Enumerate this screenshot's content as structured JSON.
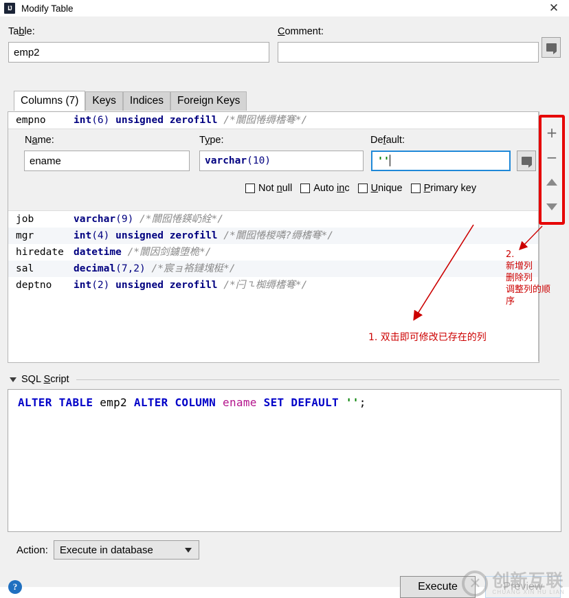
{
  "window": {
    "title": "Modify Table",
    "icon": "IJ",
    "close_label": "✕"
  },
  "form": {
    "table_label": "Table:",
    "table_label_mnemonic": "b",
    "table_value": "emp2",
    "comment_label": "Comment:",
    "comment_value": "",
    "comment_memo_icon": "memo-icon"
  },
  "tabs": [
    {
      "label": "Columns (7)",
      "active": true
    },
    {
      "label": "Keys",
      "active": false
    },
    {
      "label": "Indices",
      "active": false
    },
    {
      "label": "Foreign Keys",
      "active": false
    }
  ],
  "columns_above": [
    {
      "name": "empno",
      "type": "int",
      "args": "(6)",
      "suffix": " unsigned zerofill",
      "comment": "/*闤囮惓缛榰弿*/"
    }
  ],
  "editor": {
    "name_label": "Name:",
    "name_value": "ename",
    "type_label": "Type:",
    "type_value_kw": "varchar",
    "type_value_args": "(10)",
    "default_label": "Default:",
    "default_value": "''",
    "default_memo_icon": "memo-icon",
    "checkboxes": [
      {
        "label": "Not null",
        "checked": false
      },
      {
        "label": "Auto inc",
        "checked": false
      },
      {
        "label": "Unique",
        "checked": false
      },
      {
        "label": "Primary key",
        "checked": false
      }
    ]
  },
  "columns_below": [
    {
      "name": "job",
      "type": "varchar",
      "args": "(9)",
      "suffix": "",
      "comment": "/*闤囮惓鍈屷絟*/"
    },
    {
      "name": "mgr",
      "type": "int",
      "args": "(4)",
      "suffix": " unsigned zerofill",
      "comment": "/*闤囮惓椶噒?缛榰弿*/"
    },
    {
      "name": "hiredate",
      "type": "datetime",
      "args": "",
      "suffix": "",
      "comment": "/*闤因剑鐪堕桅*/"
    },
    {
      "name": "sal",
      "type": "decimal",
      "args": "(7,2)",
      "suffix": "",
      "comment": "/*宸ョ袼鏈塊梃*/"
    },
    {
      "name": "deptno",
      "type": "int",
      "args": "(2)",
      "suffix": " unsigned zerofill",
      "comment": "/*闩㇍椥缛榰弿*/"
    }
  ],
  "toolbar": {
    "add_label": "+",
    "remove_label": "−",
    "move_up_icon": "triangle-up-icon",
    "move_down_icon": "triangle-down-icon",
    "highlight_color": "#e60000"
  },
  "annotations": {
    "one": "1.  双击即可修改已存在的列",
    "two": "2.\n新增列\n删除列\n调整列的顺序",
    "color": "#cc0000"
  },
  "sql_section": {
    "title": "SQL Script",
    "collapse_icon": "caret-down-icon",
    "statement": {
      "tokens": [
        {
          "text": "ALTER",
          "kind": "kw"
        },
        {
          "text": " ",
          "kind": "plain"
        },
        {
          "text": "TABLE",
          "kind": "kw"
        },
        {
          "text": " ",
          "kind": "plain"
        },
        {
          "text": "emp2",
          "kind": "ident"
        },
        {
          "text": " ",
          "kind": "plain"
        },
        {
          "text": "ALTER",
          "kind": "kw"
        },
        {
          "text": " ",
          "kind": "plain"
        },
        {
          "text": "COLUMN",
          "kind": "kw"
        },
        {
          "text": " ",
          "kind": "plain"
        },
        {
          "text": "ename",
          "kind": "colname"
        },
        {
          "text": " ",
          "kind": "plain"
        },
        {
          "text": "SET",
          "kind": "kw"
        },
        {
          "text": " ",
          "kind": "plain"
        },
        {
          "text": "DEFAULT",
          "kind": "kw"
        },
        {
          "text": " ",
          "kind": "plain"
        },
        {
          "text": "''",
          "kind": "strlit"
        },
        {
          "text": ";",
          "kind": "punct"
        }
      ],
      "plain": "ALTER TABLE emp2 ALTER COLUMN ename SET DEFAULT '';"
    }
  },
  "footer": {
    "action_label": "Action:",
    "action_value": "Execute in database",
    "action_options": [
      "Execute in database"
    ],
    "help_label": "?",
    "execute_label": "Execute",
    "preview_label": "Preview",
    "preview_disabled": true
  },
  "watermark": {
    "mark": "✕",
    "cn": "创新互联",
    "en": "CHUANG XIN HU LIAN"
  }
}
